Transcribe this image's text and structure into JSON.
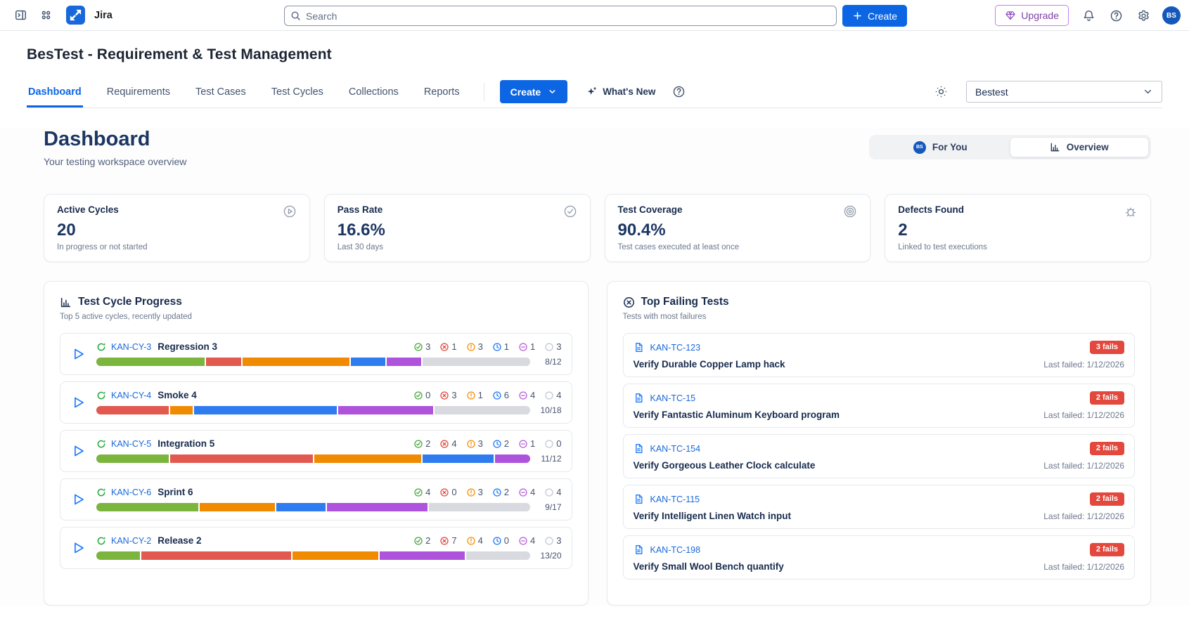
{
  "topbar": {
    "product_name": "Jira",
    "search_placeholder": "Search",
    "create_label": "Create",
    "upgrade_label": "Upgrade",
    "avatar_initials": "BS",
    "icons": [
      "sidebar-toggle-icon",
      "app-switcher-icon",
      "jira-logo",
      "search-icon",
      "plus-icon",
      "gem-icon",
      "notifications-icon",
      "help-icon",
      "settings-icon"
    ]
  },
  "page": {
    "title": "BesTest - Requirement & Test Management",
    "tabs": [
      "Dashboard",
      "Requirements",
      "Test Cases",
      "Test Cycles",
      "Collections",
      "Reports"
    ],
    "active_tab": "Dashboard",
    "create_label": "Create",
    "whats_new_label": "What's New",
    "workspace_select_value": "Bestest"
  },
  "dashboard": {
    "title": "Dashboard",
    "subtitle": "Your testing workspace overview",
    "view_toggle": {
      "for_you_label": "For You",
      "for_you_avatar": "BS",
      "overview_label": "Overview",
      "active": "Overview"
    }
  },
  "stats": [
    {
      "title": "Active Cycles",
      "value": "20",
      "subtitle": "In progress or not started",
      "icon": "play-circle-icon"
    },
    {
      "title": "Pass Rate",
      "value": "16.6%",
      "subtitle": "Last 30 days",
      "icon": "check-circle-icon"
    },
    {
      "title": "Test Coverage",
      "value": "90.4%",
      "subtitle": "Test cases executed at least once",
      "icon": "target-icon"
    },
    {
      "title": "Defects Found",
      "value": "2",
      "subtitle": "Linked to test executions",
      "icon": "bug-icon"
    }
  ],
  "test_cycle_progress": {
    "title": "Test Cycle Progress",
    "subtitle": "Top 5 active cycles, recently updated",
    "status_colors": {
      "passed": "#7CB53E",
      "failed": "#E25950",
      "blocked": "#F08A00",
      "in_progress": "#2E7CEF",
      "skipped": "#AE53DC",
      "not_run": "#D8DADF"
    },
    "rows": [
      {
        "key": "KAN-CY-3",
        "name": "Regression 3",
        "counts": {
          "passed": 3,
          "failed": 1,
          "blocked": 3,
          "in_progress": 1,
          "skipped": 1,
          "not_run": 3
        },
        "executed": "8/12"
      },
      {
        "key": "KAN-CY-4",
        "name": "Smoke 4",
        "counts": {
          "passed": 0,
          "failed": 3,
          "blocked": 1,
          "in_progress": 6,
          "skipped": 4,
          "not_run": 4
        },
        "executed": "10/18"
      },
      {
        "key": "KAN-CY-5",
        "name": "Integration 5",
        "counts": {
          "passed": 2,
          "failed": 4,
          "blocked": 3,
          "in_progress": 2,
          "skipped": 1,
          "not_run": 0
        },
        "executed": "11/12"
      },
      {
        "key": "KAN-CY-6",
        "name": "Sprint 6",
        "counts": {
          "passed": 4,
          "failed": 0,
          "blocked": 3,
          "in_progress": 2,
          "skipped": 4,
          "not_run": 4
        },
        "executed": "9/17"
      },
      {
        "key": "KAN-CY-2",
        "name": "Release 2",
        "counts": {
          "passed": 2,
          "failed": 7,
          "blocked": 4,
          "in_progress": 0,
          "skipped": 4,
          "not_run": 3
        },
        "executed": "13/20"
      }
    ]
  },
  "top_failing_tests": {
    "title": "Top Failing Tests",
    "subtitle": "Tests with most failures",
    "rows": [
      {
        "key": "KAN-TC-123",
        "title": "Verify Durable Copper Lamp hack",
        "fails": "3 fails",
        "last_failed": "Last failed: 1/12/2026"
      },
      {
        "key": "KAN-TC-15",
        "title": "Verify Fantastic Aluminum Keyboard program",
        "fails": "2 fails",
        "last_failed": "Last failed: 1/12/2026"
      },
      {
        "key": "KAN-TC-154",
        "title": "Verify Gorgeous Leather Clock calculate",
        "fails": "2 fails",
        "last_failed": "Last failed: 1/12/2026"
      },
      {
        "key": "KAN-TC-115",
        "title": "Verify Intelligent Linen Watch input",
        "fails": "2 fails",
        "last_failed": "Last failed: 1/12/2026"
      },
      {
        "key": "KAN-TC-198",
        "title": "Verify Small Wool Bench quantify",
        "fails": "2 fails",
        "last_failed": "Last failed: 1/12/2026"
      }
    ]
  }
}
